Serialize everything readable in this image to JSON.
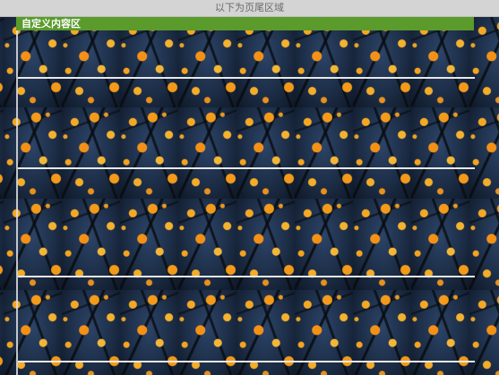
{
  "footer_area": {
    "text": "以下为页尾区域"
  },
  "custom_content": {
    "title": "自定义内容区"
  }
}
